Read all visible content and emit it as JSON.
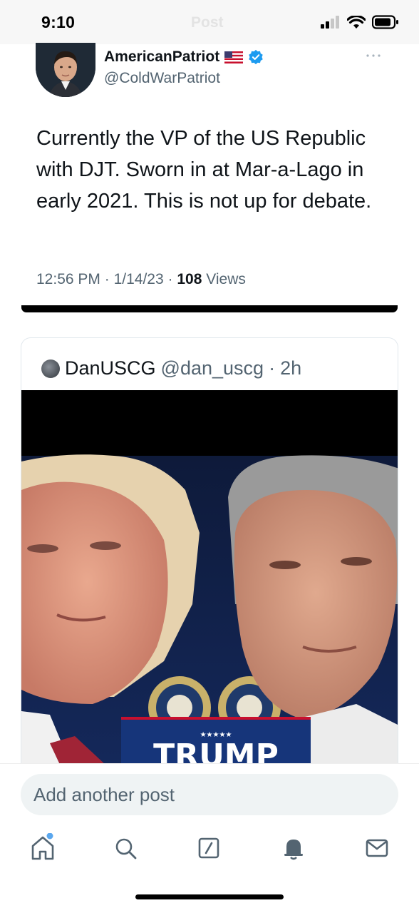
{
  "status_bar": {
    "time": "9:10",
    "ghost_title": "Post",
    "icons": [
      "signal-icon",
      "wifi-icon",
      "battery-icon"
    ]
  },
  "post": {
    "author_name": "AmericanPatriot",
    "author_handle": "@ColdWarPatriot",
    "author_flag": "us-flag-icon",
    "verified": "verified-badge-icon",
    "text": "Currently the VP of the US Republic with DJT. Sworn in at Mar-a-Lago in early 2021. This is not up for debate.",
    "time": "12:56 PM",
    "date": "1/14/23",
    "separator": "·",
    "views_count": "108",
    "views_label": "Views"
  },
  "quote": {
    "author_name": "DanUSCG",
    "author_handle": "@dan_uscg",
    "separator": "·",
    "age": "2h",
    "image_banner_text": "TRUMP",
    "image_banner_stars": "★★★★★"
  },
  "compose": {
    "placeholder": "Add another post"
  },
  "tab_bar": {
    "items": [
      "home-icon",
      "search-icon",
      "compose-icon",
      "notifications-icon",
      "messages-icon"
    ],
    "home_badge_color": "#5aa7ee"
  },
  "colors": {
    "accent": "#1d9bf0",
    "secondary_text": "#536471",
    "primary_text": "#0f1419"
  }
}
